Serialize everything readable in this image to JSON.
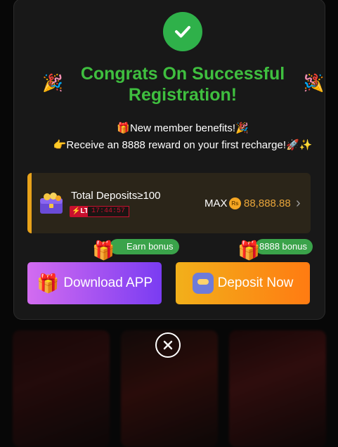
{
  "modal": {
    "title": "Congrats On Successful Registration!",
    "benefits_line": "🎁New member benefits!🎉",
    "reward_line": "👉Receive an 8888 reward on your first recharge!🚀✨"
  },
  "deposit_task": {
    "title": "Total Deposits≥100",
    "badge": "⚡LT",
    "timer": "17:44:57",
    "max_label": "MAX",
    "currency_symbol": "Rs",
    "amount": "88,888.88",
    "accent_color": "#e8a21a"
  },
  "tags": {
    "earn_bonus": "Earn bonus",
    "deposit_bonus": "8888 bonus"
  },
  "buttons": {
    "download_label": "Download APP",
    "deposit_label": "Deposit Now"
  },
  "icons": {
    "success": "check-icon",
    "close": "close-icon",
    "party": "party-popper-icon",
    "gift": "gift-icon",
    "chevron": "chevron-right-icon"
  },
  "colors": {
    "title": "#3fbf3f",
    "success_badge": "#2fb14a",
    "download_gradient_start": "#d36cf0",
    "download_gradient_end": "#7a3cf2",
    "deposit_gradient_start": "#f2b01a",
    "deposit_gradient_end": "#ff7b12",
    "tag_bg": "#3aa34a"
  }
}
